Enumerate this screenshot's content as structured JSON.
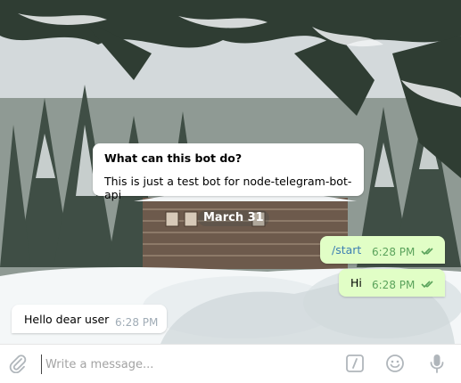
{
  "bot_info": {
    "title": "What can this bot do?",
    "description": "This is just a test bot for node-telegram-bot-api"
  },
  "date_separator": "March 31",
  "messages": [
    {
      "direction": "out",
      "text": "/start",
      "time": "6:28 PM",
      "status": "read"
    },
    {
      "direction": "out",
      "text": "Hi",
      "time": "6:28 PM",
      "status": "read"
    },
    {
      "direction": "in",
      "text": "Hello dear user",
      "time": "6:28 PM"
    }
  ],
  "composer": {
    "placeholder": "Write a message...",
    "value": ""
  },
  "icons": {
    "attach": "paperclip-icon",
    "commands": "slash-command-icon",
    "emoji": "emoji-icon",
    "voice": "microphone-icon",
    "read_status": "double-check-icon"
  },
  "colors": {
    "outgoing_bubble": "#e1fec6",
    "incoming_bubble": "#ffffff",
    "command_text": "#3d7fb2",
    "out_time": "#5ba35c",
    "icon_gray": "#b0b6bb"
  }
}
